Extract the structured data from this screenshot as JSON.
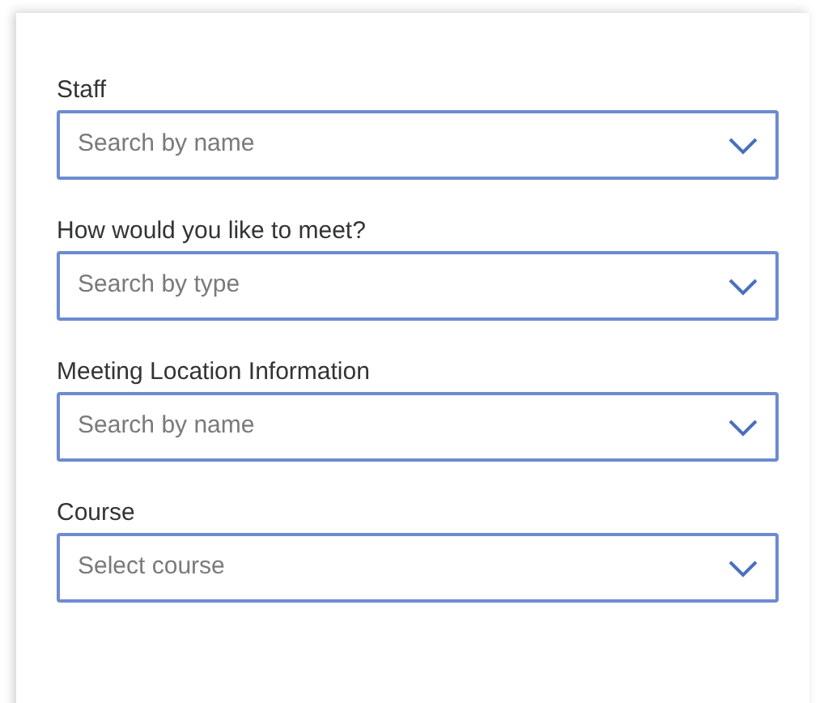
{
  "fields": [
    {
      "label": "Staff",
      "placeholder": "Search by name"
    },
    {
      "label": "How would you like to meet?",
      "placeholder": "Search by type"
    },
    {
      "label": "Meeting Location Information",
      "placeholder": "Search by name"
    },
    {
      "label": "Course",
      "placeholder": "Select course"
    }
  ]
}
